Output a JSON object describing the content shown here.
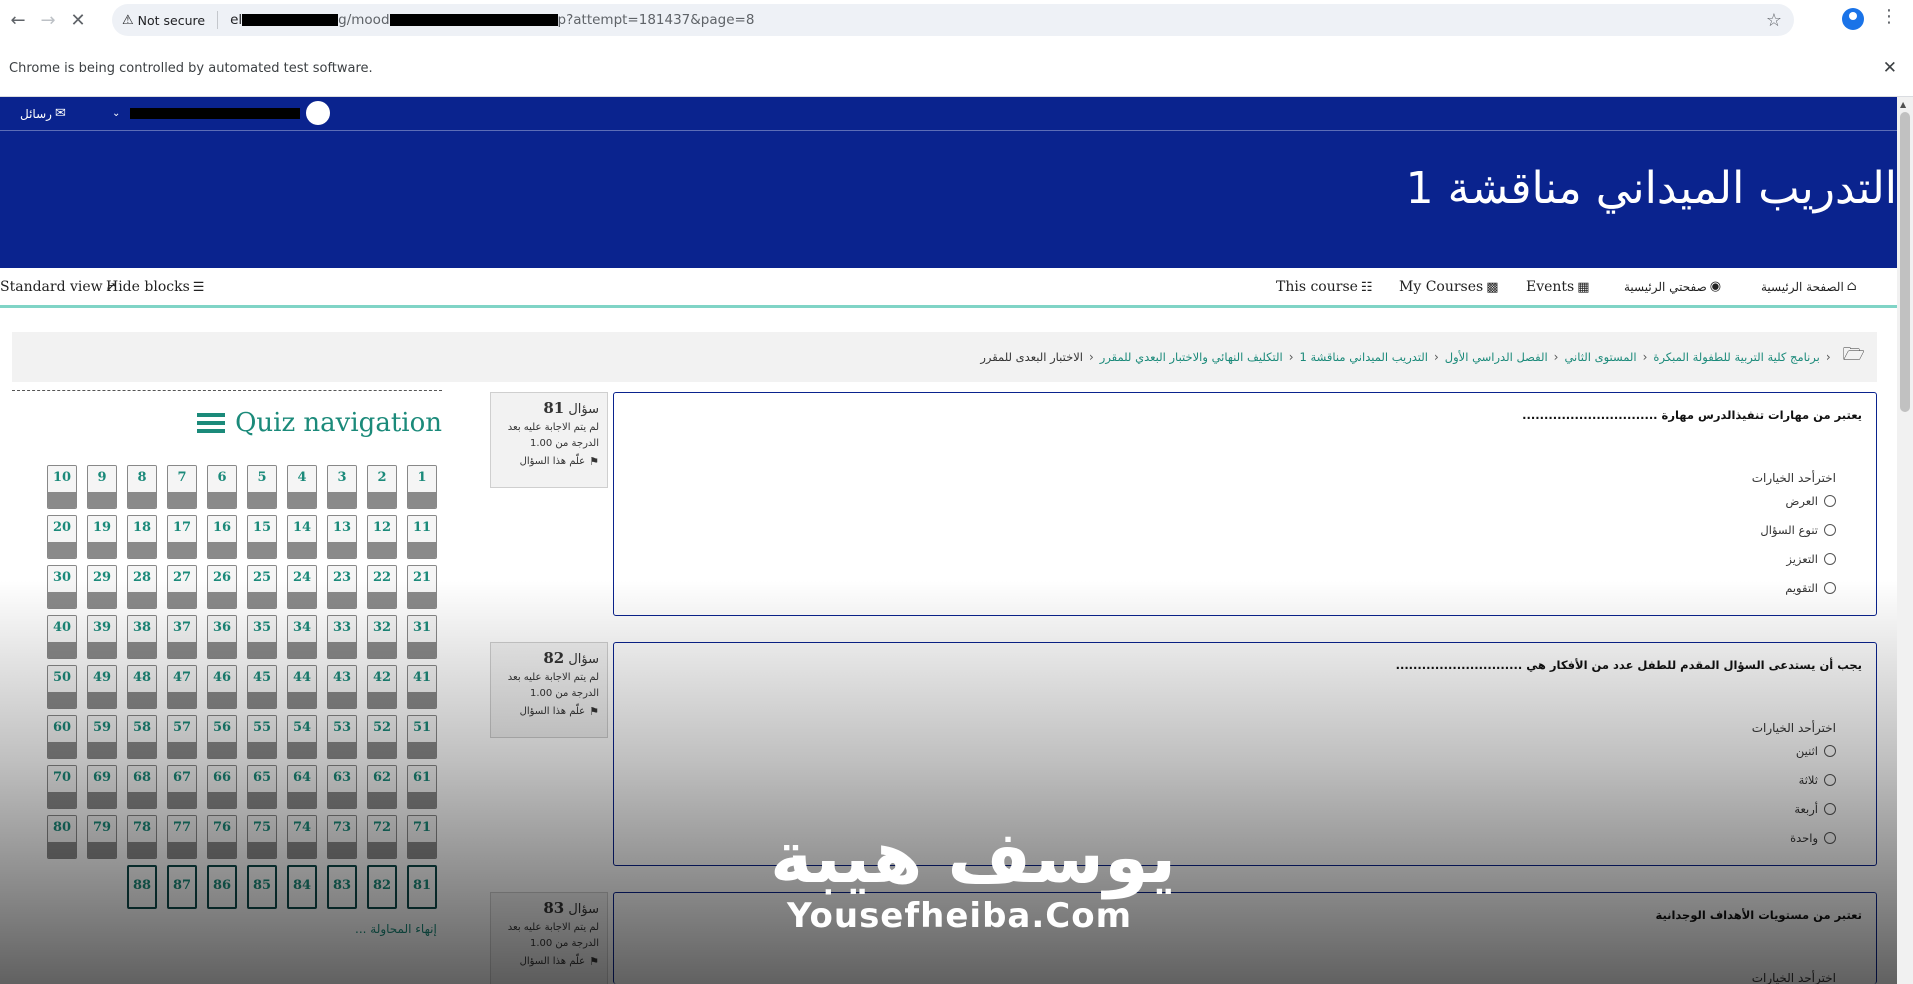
{
  "browser": {
    "not_secure": "Not secure",
    "url_prefix": "el",
    "url_mid": "g/mood",
    "url_suffix": "p?attempt=181437&page=8",
    "infobar": "Chrome is being controlled by automated test software."
  },
  "topbar": {
    "messages": "رسائل"
  },
  "course_title": "التدريب الميداني مناقشة 1",
  "nav": {
    "home": "الصفحة الرئيسية",
    "dashboard": "صفحتي الرئيسية",
    "events": "Events",
    "my_courses": "My Courses",
    "this_course": "This course",
    "hide_blocks": "Hide blocks",
    "standard_view": "Standard view"
  },
  "breadcrumb": [
    "برنامج كلية التربية للطفولة المبكرة",
    "المستوى الثاني",
    "الفصل الدراسي الأول",
    "التدريب الميداني مناقشة 1",
    "التكليف النهائي والاختبار البعدي للمقرر",
    "الاختبار البعدى للمقرر"
  ],
  "quiz_nav": {
    "title": "Quiz navigation",
    "buttons": [
      "1",
      "2",
      "3",
      "4",
      "5",
      "6",
      "7",
      "8",
      "9",
      "10",
      "11",
      "12",
      "13",
      "14",
      "15",
      "16",
      "17",
      "18",
      "19",
      "20",
      "21",
      "22",
      "23",
      "24",
      "25",
      "26",
      "27",
      "28",
      "29",
      "30",
      "31",
      "32",
      "33",
      "34",
      "35",
      "36",
      "37",
      "38",
      "39",
      "40",
      "41",
      "42",
      "43",
      "44",
      "45",
      "46",
      "47",
      "48",
      "49",
      "50",
      "51",
      "52",
      "53",
      "54",
      "55",
      "56",
      "57",
      "58",
      "59",
      "60",
      "61",
      "62",
      "63",
      "64",
      "65",
      "66",
      "67",
      "68",
      "69",
      "70",
      "71",
      "72",
      "73",
      "74",
      "75",
      "76",
      "77",
      "78",
      "79",
      "80",
      "81",
      "82",
      "83",
      "84",
      "85",
      "86",
      "87",
      "88"
    ],
    "finish": "إنهاء المحاولة ..."
  },
  "questions": [
    {
      "label": "سؤال",
      "number": "81",
      "status": "لم يتم الاجابة عليه بعد",
      "grade": "الدرجة من 1.00",
      "flag": "علّم هذا السؤال",
      "text": "يعتبر من مهارات تنفيذالدرس مهارة ...............................",
      "prompt": "اخترأحد الخيارات",
      "options": [
        "العرض",
        "تنوع السؤال",
        "التعزيز",
        "التقويم"
      ]
    },
    {
      "label": "سؤال",
      "number": "82",
      "status": "لم يتم الاجابة عليه بعد",
      "grade": "الدرجة من 1.00",
      "flag": "علّم هذا السؤال",
      "text": "يجب أن يستدعى السؤال المقدم للطفل عدد من الأفكار هي .............................",
      "prompt": "اخترأحد الخيارات",
      "options": [
        "اثنين",
        "ثلاثة",
        "أربعة",
        "واحدة"
      ]
    },
    {
      "label": "سؤال",
      "number": "83",
      "status": "لم يتم الاجابة عليه بعد",
      "grade": "الدرجة من 1.00",
      "flag": "علّم هذا السؤال",
      "text": "تعتبر من مستويات الأهداف الوجدانية",
      "prompt": "اخترأحد الخيارات"
    }
  ],
  "watermark": {
    "arabic": "يوسف هيبة",
    "english": "Yousefheiba.Com"
  }
}
